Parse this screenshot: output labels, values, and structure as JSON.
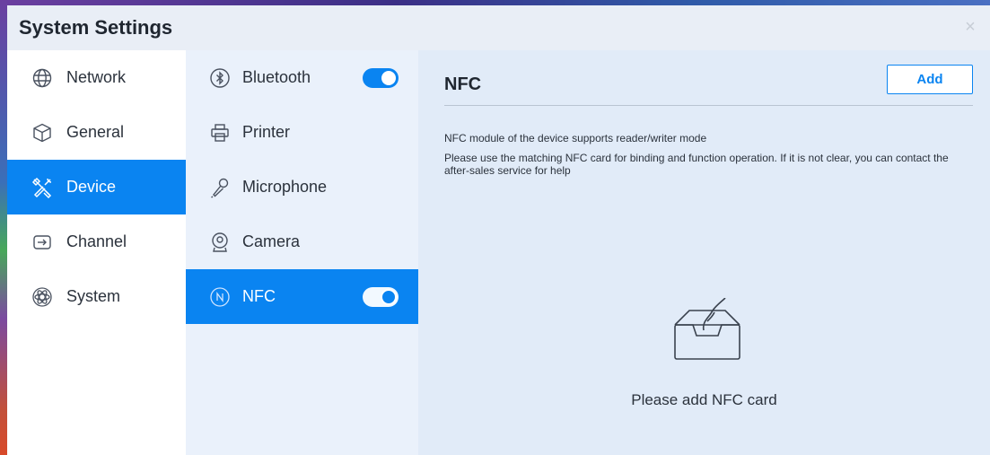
{
  "window": {
    "title": "System Settings",
    "close_glyph": "×"
  },
  "sidebar": {
    "items": [
      {
        "label": "Network",
        "icon": "globe-icon",
        "active": false
      },
      {
        "label": "General",
        "icon": "cube-icon",
        "active": false
      },
      {
        "label": "Device",
        "icon": "tools-icon",
        "active": true
      },
      {
        "label": "Channel",
        "icon": "input-icon",
        "active": false
      },
      {
        "label": "System",
        "icon": "atom-icon",
        "active": false
      }
    ]
  },
  "device_menu": {
    "items": [
      {
        "label": "Bluetooth",
        "icon": "bluetooth-icon",
        "toggle": true,
        "active": false
      },
      {
        "label": "Printer",
        "icon": "printer-icon",
        "active": false
      },
      {
        "label": "Microphone",
        "icon": "microphone-icon",
        "active": false
      },
      {
        "label": "Camera",
        "icon": "camera-icon",
        "active": false
      },
      {
        "label": "NFC",
        "icon": "nfc-icon",
        "toggle": true,
        "active": true
      }
    ]
  },
  "panel": {
    "title": "NFC",
    "add_label": "Add",
    "description_1": "NFC module of the device supports reader/writer mode",
    "description_2": "Please use the matching NFC card for binding and function operation. If it is not clear, you can contact the after-sales service for help",
    "empty_icon": "empty-inbox-icon",
    "empty_text": "Please add NFC card"
  },
  "colors": {
    "accent": "#0a84f1",
    "panel_bg": "#e1ebf8",
    "menu_bg": "#eaf1fb"
  }
}
